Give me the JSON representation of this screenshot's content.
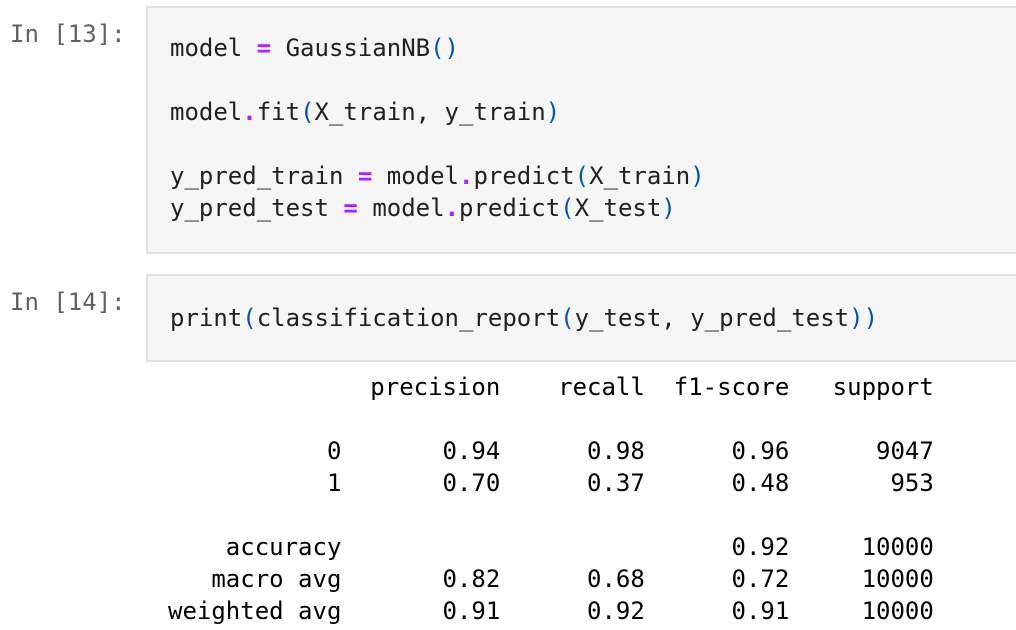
{
  "cells": [
    {
      "prompt": "In [13]:",
      "lines": [
        [
          "model",
          " = ",
          "GaussianNB",
          "()"
        ],
        [],
        [
          "model",
          ".",
          "fit",
          "(",
          "X_train, y_train",
          ")"
        ],
        [],
        [
          "y_pred_train",
          " = ",
          "model",
          ".",
          "predict",
          "(",
          "X_train",
          ")"
        ],
        [
          "y_pred_test",
          " = ",
          "model",
          ".",
          "predict",
          "(",
          "X_test",
          ")"
        ]
      ]
    },
    {
      "prompt": "In [14]:",
      "lines": [
        [
          "print",
          "(",
          "classification_report",
          "(",
          "y_test, y_pred_test",
          "))"
        ]
      ]
    }
  ],
  "output": {
    "lines": [
      "              precision    recall  f1-score   support",
      "",
      "           0       0.94      0.98      0.96      9047",
      "           1       0.70      0.37      0.48       953",
      "",
      "    accuracy                           0.92     10000",
      "   macro avg       0.82      0.68      0.72     10000",
      "weighted avg       0.91      0.92      0.91     10000"
    ]
  },
  "colors": {
    "cell_bg": "#f5f5f5",
    "cell_border": "#e0e0e0",
    "prompt": "#616161",
    "operator": "#aa22ff",
    "paren": "#0055aa"
  }
}
